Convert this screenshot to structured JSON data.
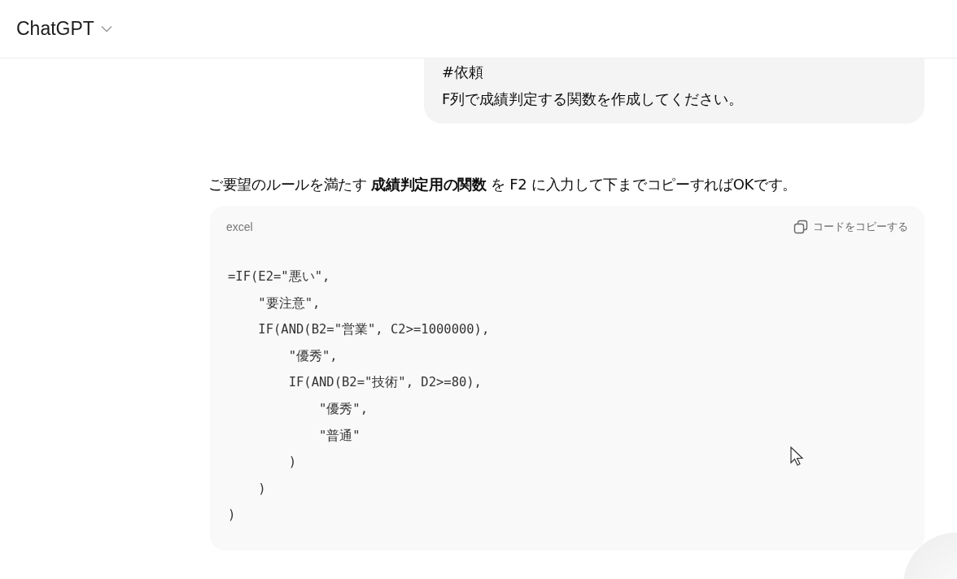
{
  "header": {
    "title": "ChatGPT"
  },
  "user_message": {
    "lines": [
      "#依頼",
      "F列で成績判定する関数を作成してください。"
    ]
  },
  "assistant_message": {
    "text": "ご要望のルールを満たす **成績判定用の関数** を F2 に入力して下までコピーすればOKです。",
    "code_block": {
      "language": "excel",
      "copy_label": "コードをコピーする",
      "lines": [
        "=IF(E2=\"悪い\",",
        "    \"要注意\",",
        "    IF(AND(B2=\"営業\", C2>=1000000),",
        "        \"優秀\",",
        "        IF(AND(B2=\"技術\", D2>=80),",
        "            \"優秀\",",
        "            \"普通\"",
        "        )",
        "    )",
        ")"
      ]
    }
  }
}
